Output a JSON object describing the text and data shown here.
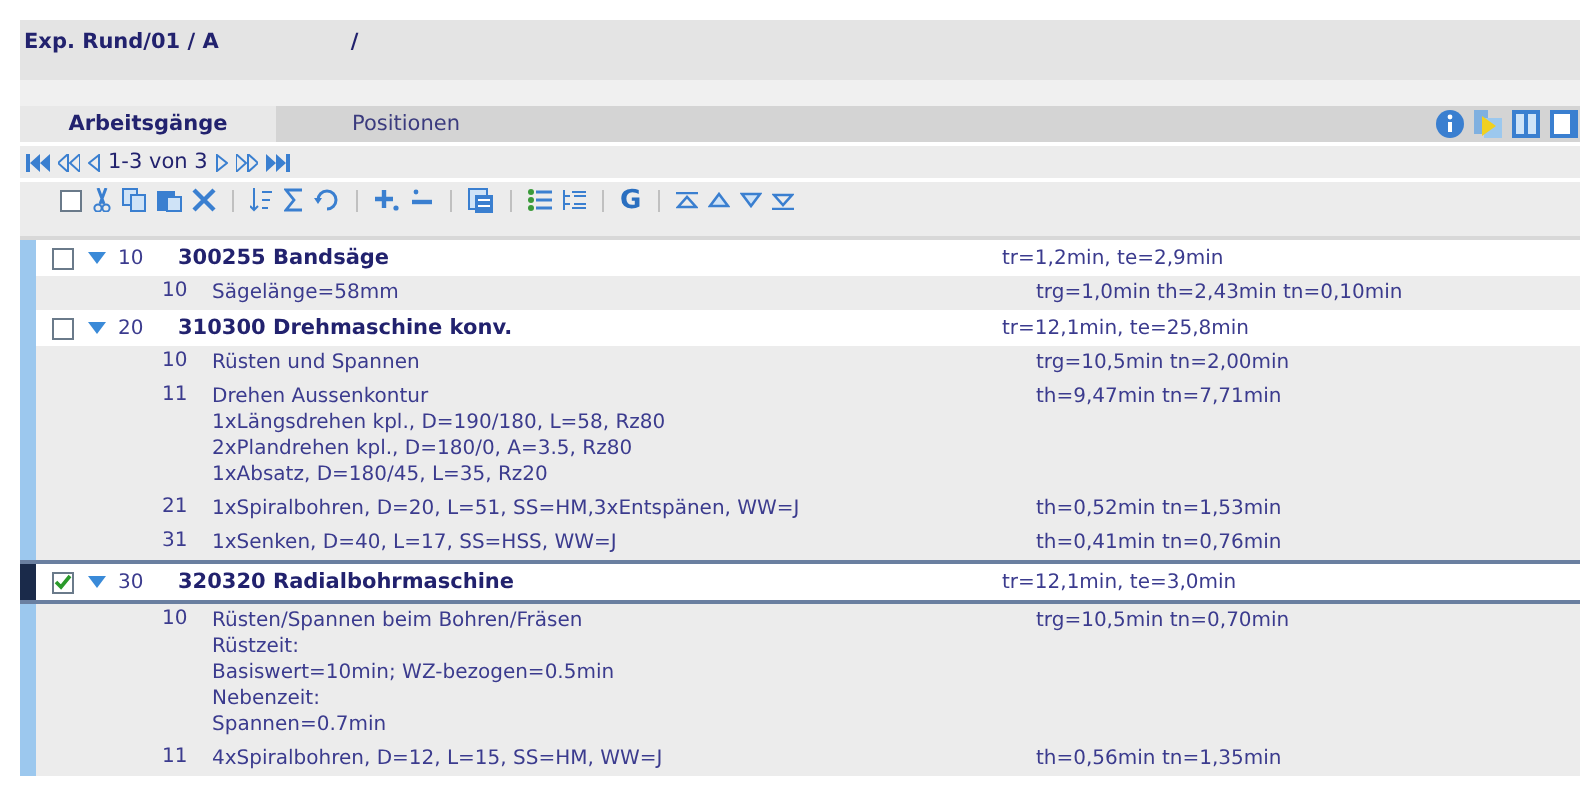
{
  "header": {
    "title": "Exp. Rund/01 / A",
    "suffix": "/"
  },
  "tabs": [
    {
      "label": "Arbeitsgänge",
      "selected": true
    },
    {
      "label": "Positionen",
      "selected": false
    }
  ],
  "pager": {
    "range": "1-3 von 3"
  },
  "toolbar": {
    "g_label": "G",
    "select_all": false
  },
  "operations": [
    {
      "number": "10",
      "title": "300255 Bandsäge",
      "times": "tr=1,2min, te=2,9min",
      "checked": false,
      "expanded": true,
      "selected": false,
      "steps": [
        {
          "number": "10",
          "lines": [
            "Sägelänge=58mm"
          ],
          "times": "trg=1,0min th=2,43min tn=0,10min"
        }
      ]
    },
    {
      "number": "20",
      "title": "310300 Drehmaschine konv.",
      "times": "tr=12,1min, te=25,8min",
      "checked": false,
      "expanded": true,
      "selected": false,
      "steps": [
        {
          "number": "10",
          "lines": [
            "Rüsten und Spannen"
          ],
          "times": "trg=10,5min tn=2,00min"
        },
        {
          "number": "11",
          "lines": [
            "Drehen Aussenkontur",
            "1xLängsdrehen kpl., D=190/180, L=58, Rz80",
            "2xPlandrehen kpl., D=180/0, A=3.5, Rz80",
            "1xAbsatz, D=180/45, L=35, Rz20"
          ],
          "times": "th=9,47min tn=7,71min"
        },
        {
          "number": "21",
          "lines": [
            "1xSpiralbohren, D=20, L=51, SS=HM,3xEntspänen, WW=J"
          ],
          "times": "th=0,52min tn=1,53min"
        },
        {
          "number": "31",
          "lines": [
            "1xSenken, D=40, L=17, SS=HSS, WW=J"
          ],
          "times": "th=0,41min tn=0,76min"
        }
      ]
    },
    {
      "number": "30",
      "title": "320320 Radialbohrmaschine",
      "times": "tr=12,1min, te=3,0min",
      "checked": true,
      "expanded": true,
      "selected": true,
      "steps": [
        {
          "number": "10",
          "lines": [
            "Rüsten/Spannen beim Bohren/Fräsen",
            "Rüstzeit:",
            "Basiswert=10min; WZ-bezogen=0.5min",
            "Nebenzeit:",
            "Spannen=0.7min"
          ],
          "times": "trg=10,5min tn=0,70min"
        },
        {
          "number": "11",
          "lines": [
            "4xSpiralbohren, D=12, L=15, SS=HM, WW=J"
          ],
          "times": "th=0,56min tn=1,35min"
        }
      ]
    }
  ]
}
